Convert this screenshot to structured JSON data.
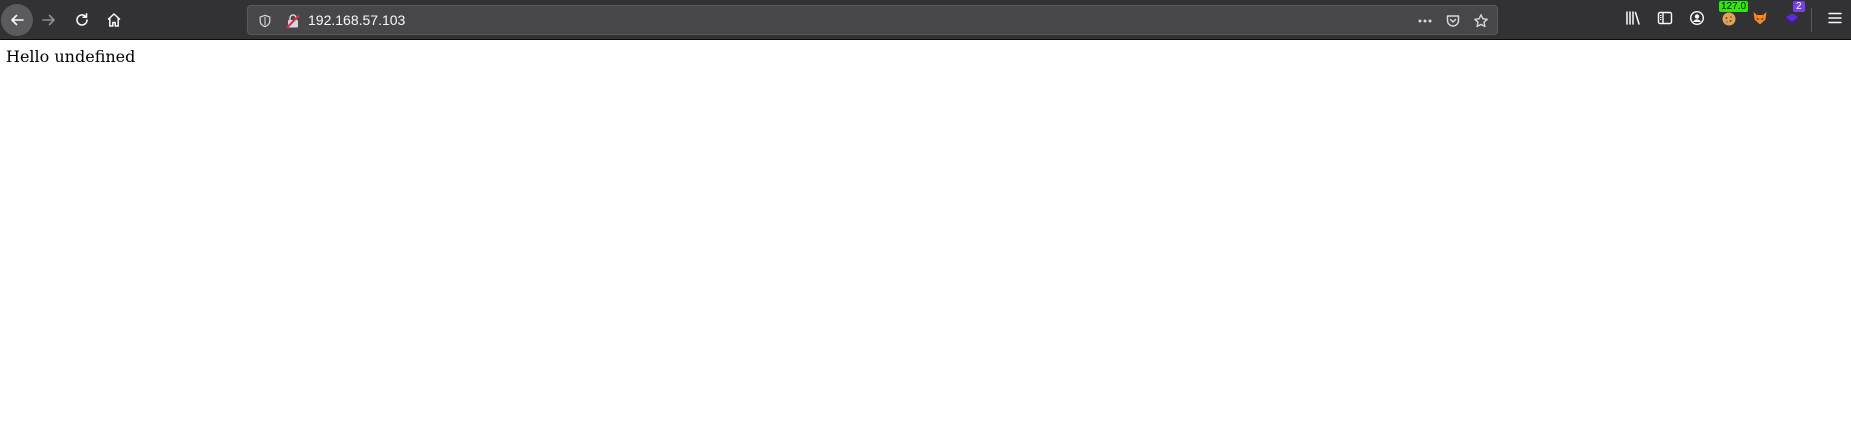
{
  "toolbar": {
    "back_icon": "arrow-left-icon",
    "forward_icon": "arrow-right-icon",
    "reload_icon": "reload-icon",
    "home_icon": "home-icon"
  },
  "urlbar": {
    "url": "192.168.57.103",
    "tracking_icon": "shield-icon",
    "security_icon": "insecure-lock-icon",
    "page_actions": [
      "more-icon",
      "pocket-icon",
      "bookmark-star-icon"
    ]
  },
  "right_toolbar": {
    "library_icon": "library-icon",
    "sidebar_icon": "sidebar-icon",
    "account_icon": "account-icon",
    "extensions": [
      {
        "icon": "cookie-extension-icon",
        "badge": "127.0"
      },
      {
        "icon": "fox-extension-icon",
        "badge": ""
      },
      {
        "icon": "puzzle-extension-icon",
        "badge": "2"
      }
    ],
    "menu_icon": "hamburger-menu-icon"
  },
  "colors": {
    "toolbar_bg": "#323234",
    "urlbar_bg": "#474749",
    "badge_green": "#30e60b",
    "badge_purple": "#7542e5"
  },
  "page": {
    "text": "Hello undefined"
  }
}
